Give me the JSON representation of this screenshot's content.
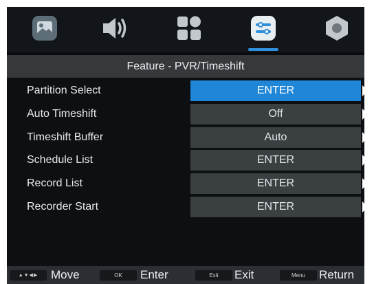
{
  "tabs": [
    {
      "name": "picture-icon",
      "selected": false
    },
    {
      "name": "sound-icon",
      "selected": false
    },
    {
      "name": "channel-icon",
      "selected": false
    },
    {
      "name": "feature-icon",
      "selected": true
    },
    {
      "name": "setup-icon",
      "selected": false
    }
  ],
  "header": {
    "title": "Feature - PVR/Timeshift"
  },
  "menu": {
    "items": [
      {
        "label": "Partition Select",
        "value": "ENTER"
      },
      {
        "label": "Auto Timeshift",
        "value": "Off"
      },
      {
        "label": "Timeshift Buffer",
        "value": "Auto"
      },
      {
        "label": "Schedule List",
        "value": "ENTER"
      },
      {
        "label": "Record List",
        "value": "ENTER"
      },
      {
        "label": "Recorder Start",
        "value": "ENTER"
      }
    ],
    "selected_index": 0
  },
  "footer": {
    "move_key": "▲▼◀▶",
    "move_label": "Move",
    "enter_key": "OK",
    "enter_label": "Enter",
    "exit_key": "Exit",
    "exit_label": "Exit",
    "return_key": "Menu",
    "return_label": "Return"
  },
  "colors": {
    "accent": "#1f86d8",
    "panel": "#3a3f42",
    "background": "#0d0f12"
  }
}
